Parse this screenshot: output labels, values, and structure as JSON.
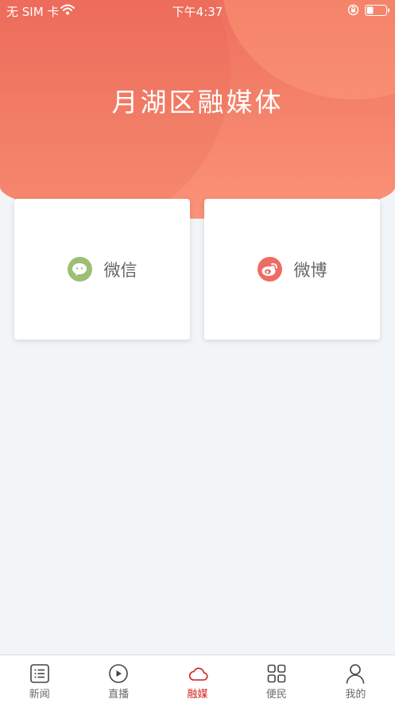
{
  "status_bar": {
    "carrier": "无 SIM 卡",
    "time": "下午4:37",
    "battery_level": 0.35
  },
  "header": {
    "title": "月湖区融媒体"
  },
  "cards": [
    {
      "label": "微信",
      "icon": "wechat-icon",
      "color": "#9dbe74"
    },
    {
      "label": "微博",
      "icon": "weibo-icon",
      "color": "#ed6d63"
    }
  ],
  "tabbar": {
    "active": 2,
    "active_color": "#d21d1d",
    "items": [
      {
        "label": "新闻",
        "icon": "news-list-icon"
      },
      {
        "label": "直播",
        "icon": "play-icon"
      },
      {
        "label": "融媒",
        "icon": "cloud-icon"
      },
      {
        "label": "便民",
        "icon": "grid-icon"
      },
      {
        "label": "我的",
        "icon": "person-icon"
      }
    ]
  }
}
